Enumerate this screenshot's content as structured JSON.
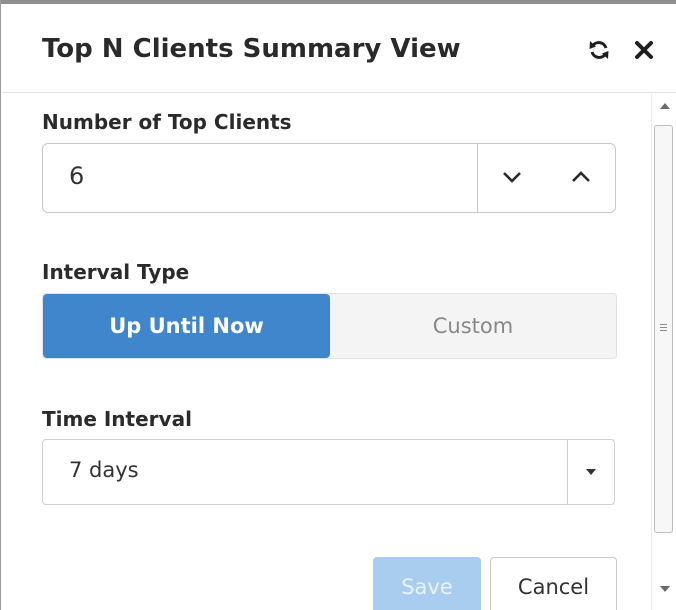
{
  "dialog": {
    "title": "Top N Clients Summary View",
    "refresh_icon": "refresh-icon",
    "close_icon": "close-icon"
  },
  "form": {
    "top_clients": {
      "label": "Number of Top Clients",
      "value": "6",
      "decrement_icon": "chevron-down-icon",
      "increment_icon": "chevron-up-icon"
    },
    "interval_type": {
      "label": "Interval Type",
      "options": [
        "Up Until Now",
        "Custom"
      ],
      "selected": "Up Until Now"
    },
    "time_interval": {
      "label": "Time Interval",
      "value": "7 days",
      "caret_icon": "caret-down-icon"
    }
  },
  "buttons": {
    "save": "Save",
    "cancel": "Cancel"
  },
  "colors": {
    "accent": "#3f86cd",
    "save_disabled": "#a9cdef"
  }
}
